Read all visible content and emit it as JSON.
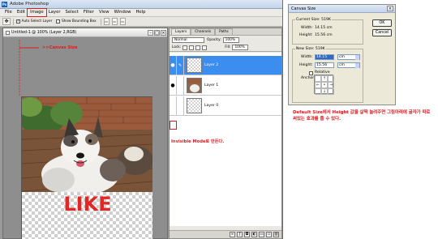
{
  "ps_window": {
    "title": "Adobe Photoshop",
    "logo": "Ps",
    "menu": [
      "File",
      "Edit",
      "Image",
      "Layer",
      "Select",
      "Filter",
      "View",
      "Window",
      "Help"
    ],
    "highlighted_menu": "Image",
    "options": {
      "tool_icon": "move-tool-icon",
      "auto_select_label": "Auto Select Layer",
      "show_bounding_label": "Show Bounding Box"
    }
  },
  "document": {
    "title": "Untitled-1 @ 100% (Layer 2,RGB)",
    "canvas_size_note": ">>Canvas Size",
    "like_text": "LIKE"
  },
  "layers_panel": {
    "tabs": [
      "Layers",
      "Channels",
      "Paths"
    ],
    "blend_mode": "Normal",
    "opacity_label": "Opacity:",
    "opacity_value": "100%",
    "lock_label": "Lock:",
    "fill_label": "Fill:",
    "fill_value": "100%",
    "layers": [
      {
        "name": "Layer 2",
        "selected": true
      },
      {
        "name": "Layer 1",
        "selected": false
      },
      {
        "name": "Layer 0",
        "selected": false
      }
    ],
    "invisible_note": "Invisible Mode로 만든다."
  },
  "dialog": {
    "title": "Canvas Size",
    "current_legend": "Current Size: 519K",
    "current_width_label": "Width:",
    "current_width_value": "14.15 cm",
    "current_height_label": "Height:",
    "current_height_value": "15.56 cm",
    "new_legend": "New Size: 519K",
    "width_label": "Width:",
    "width_value": "14.15",
    "width_unit": "cm",
    "height_label": "Height:",
    "height_value": "15.56",
    "height_unit": "cm",
    "relative_label": "Relative",
    "anchor_label": "Anchor:",
    "ok_label": "OK",
    "cancel_label": "Cancel"
  },
  "caption": "Default Size에서 Height 값을 살짝 늘려주면 그림아래에 글자가 따로 써있는 효과를 줄 수 있다.",
  "colors": {
    "annotation": "#e0191e",
    "selected_layer": "#3b8ef0"
  }
}
